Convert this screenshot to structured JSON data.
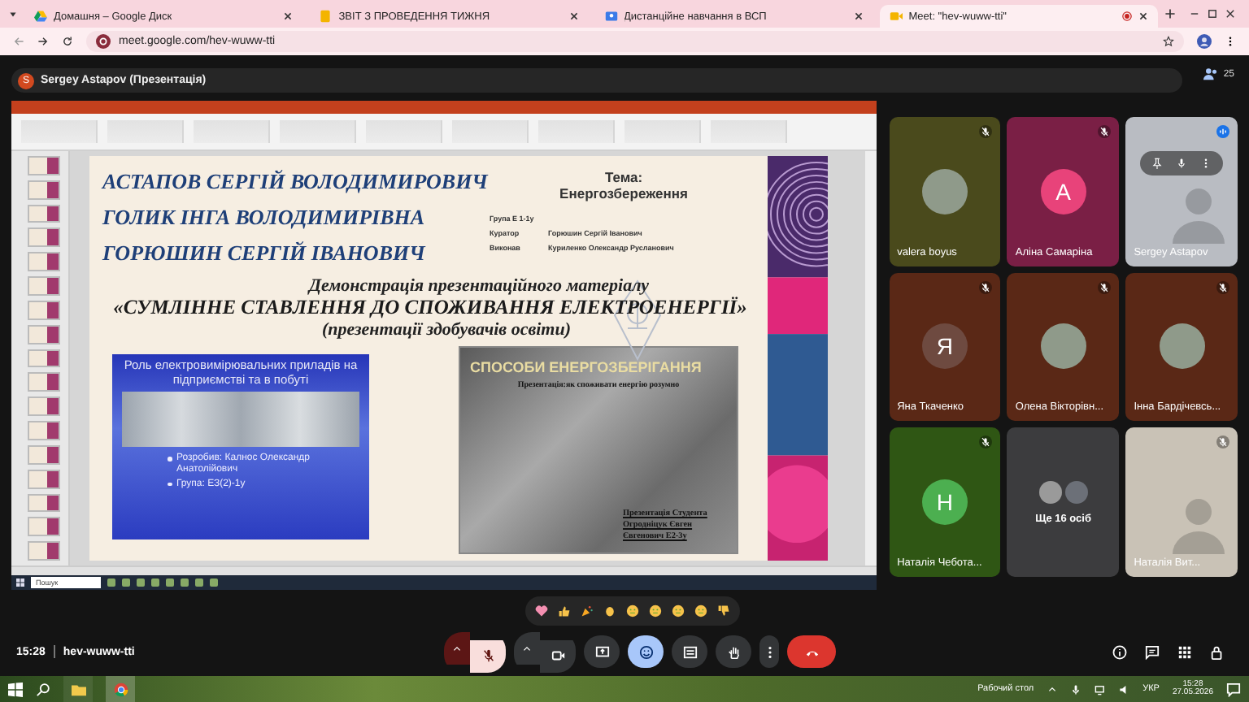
{
  "browser": {
    "tabs": [
      {
        "title": "Домашня – Google Диск",
        "kind": "drive",
        "selected": false
      },
      {
        "title": "ЗВІТ З ПРОВЕДЕННЯ ТИЖНЯ",
        "kind": "doc",
        "selected": false
      },
      {
        "title": "Дистанційне навчання в ВСП",
        "kind": "classroom",
        "selected": false
      },
      {
        "title": "Meet: \"hev-wuww-tti\"",
        "kind": "meet",
        "selected": true
      }
    ],
    "url": "meet.google.com/hev-wuww-tti"
  },
  "presenter": {
    "initial": "S",
    "label": "Sergey Astapov (Презентація)",
    "participants_count": "25"
  },
  "slide": {
    "names": [
      "АСТАПОВ СЕРГІЙ ВОЛОДИМИРОВИЧ",
      "ГОЛИК ІНГА ВОЛОДИМИРІВНА",
      "ГОРЮШИН СЕРГІЙ ІВАНОВИЧ"
    ],
    "topic_label": "Тема:",
    "topic": "Енергозбереження",
    "info": [
      {
        "label": "Група Е 1-1у"
      },
      {
        "label": "Куратор",
        "value": "Горюшин Сергій Іванович"
      },
      {
        "label": "Виконав",
        "value": "Куриленко Олександр Русланович"
      }
    ],
    "lines": [
      "Демонстрація презентаційного матеріалу",
      "«СУМЛІННЕ СТАВЛЕННЯ ДО СПОЖИВАННЯ ЕЛЕКТРОЕНЕРГІЇ»",
      "(презентації здобувачів освіти)"
    ],
    "card_1": {
      "title": "Роль електровимірювальних приладів на підприємстві та в побуті",
      "bullets": [
        "Розробив: Калнос Олександр Анатолійович",
        "Група: ЕЗ(2)-1у"
      ]
    },
    "card_2": {
      "title": "СПОСОБИ ЕНЕРГОЗБЕРІГАННЯ",
      "subtitle": "Презентація:як споживати енергію розумно",
      "author": "Презентація Студента Огродніцук Євген Євгенович Е2-3у"
    }
  },
  "shared_taskbar": {
    "search_placeholder": "Пошук"
  },
  "participants": [
    {
      "name": "valera boyus",
      "kind": "photo",
      "color": "#4a4a1c",
      "muted": true,
      "hovered": false
    },
    {
      "name": "Аліна Самаріна",
      "kind": "initial",
      "avatar": {
        "initial": "A",
        "color": "#e8437a"
      },
      "color": "#7a1f45",
      "muted": true,
      "hovered": false
    },
    {
      "name": "Sergey Astapov",
      "kind": "video",
      "color": "#b9bcc2",
      "muted": false,
      "hovered": true
    },
    {
      "name": "Яна Ткаченко",
      "kind": "initial",
      "avatar": {
        "initial": "Я",
        "color": "#6e4a40"
      },
      "color": "#5a2816",
      "muted": true,
      "hovered": false
    },
    {
      "name": "Олена Вікторівн...",
      "kind": "photo",
      "color": "#5a2816",
      "muted": true,
      "hovered": false
    },
    {
      "name": "Інна Бардічевсь...",
      "kind": "photo",
      "color": "#5a2816",
      "muted": true,
      "hovered": false
    },
    {
      "name": "Наталія Чебота...",
      "kind": "initial",
      "avatar": {
        "initial": "H",
        "color": "#4caf50"
      },
      "color": "#2f5614",
      "muted": true,
      "hovered": false
    },
    {
      "name": "Ще 16 осіб",
      "kind": "more",
      "color": "#3c3c3e",
      "muted": false,
      "hovered": false
    },
    {
      "name": "Наталія Вит...",
      "kind": "video",
      "color": "#c9c2b6",
      "muted": true,
      "hovered": false
    }
  ],
  "meeting": {
    "time": "15:28",
    "code": "hev-wuww-tti"
  },
  "controls": [
    {
      "kind": "mic",
      "on": false
    },
    {
      "kind": "camera",
      "on": true
    },
    {
      "kind": "present",
      "on": false
    },
    {
      "kind": "reactions",
      "on": true
    },
    {
      "kind": "activities",
      "on": false
    },
    {
      "kind": "hand",
      "on": false
    },
    {
      "kind": "more"
    },
    {
      "kind": "leave"
    }
  ],
  "taskbar": {
    "desktop_label": "Рабочий стол",
    "language": "УКР",
    "time": "15:28",
    "date": "27.05.2026"
  }
}
